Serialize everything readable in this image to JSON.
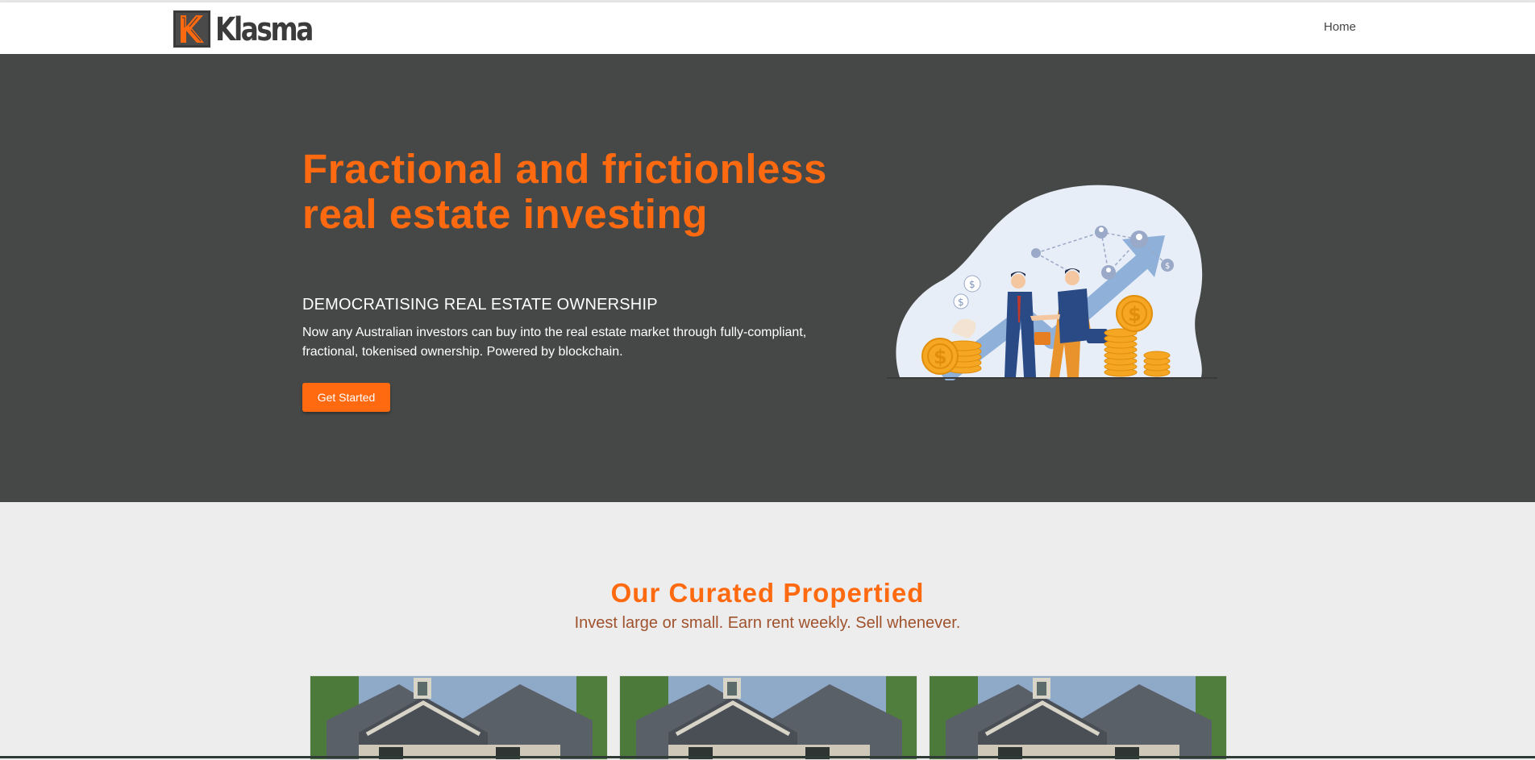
{
  "brand": {
    "name": "Klasma",
    "accent": "#ff6a10",
    "logo_icon": "klasma-k-icon"
  },
  "nav": {
    "items": [
      {
        "label": "Home"
      }
    ]
  },
  "hero": {
    "title": "Fractional and frictionless real estate investing",
    "subtitle": "DEMOCRATISING REAL ESTATE OWNERSHIP",
    "body": "Now any Australian investors can buy into the real estate market through fully-compliant, fractional, tokenised ownership. Powered by blockchain.",
    "cta_label": "Get Started",
    "illustration_icon": "handshake-investment-icon",
    "background": "#464847"
  },
  "properties": {
    "title": "Our Curated Propertied",
    "subtitle": "Invest large or small. Earn rent weekly. Sell whenever.",
    "cards": [
      {
        "image_icon": "house-photo-icon"
      },
      {
        "image_icon": "house-photo-icon"
      },
      {
        "image_icon": "house-photo-icon"
      }
    ]
  }
}
